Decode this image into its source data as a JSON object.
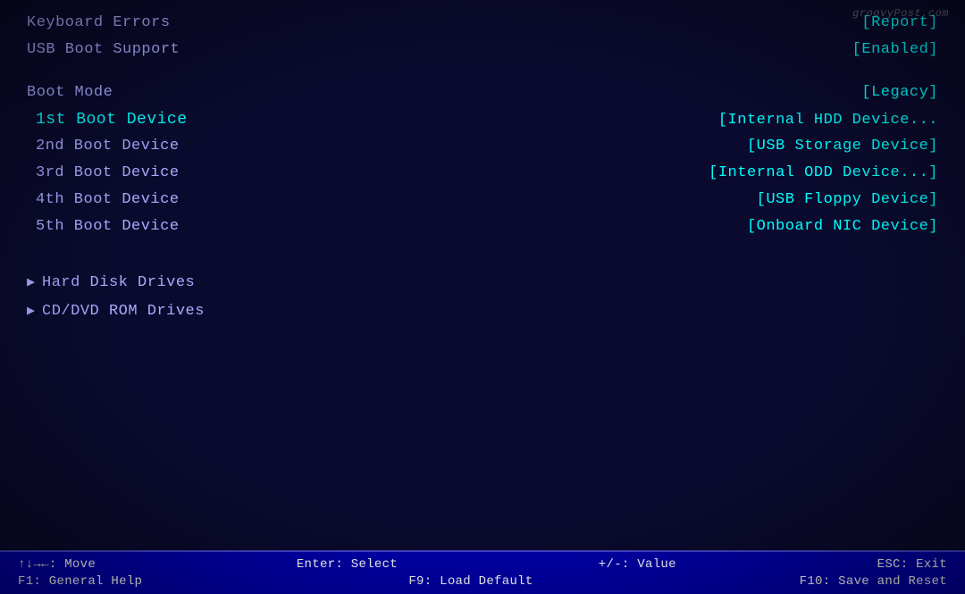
{
  "watermark": "groovyPost.com",
  "rows": [
    {
      "id": "keyboard-errors",
      "label": "Keyboard Errors",
      "value": "[Report]",
      "indent": false,
      "selected": false
    },
    {
      "id": "usb-boot-support",
      "label": "USB Boot Support",
      "value": "[Enabled]",
      "indent": false,
      "selected": false
    },
    {
      "id": "spacer1",
      "label": "",
      "value": "",
      "spacer": true
    },
    {
      "id": "boot-mode",
      "label": "Boot Mode",
      "value": "[Legacy]",
      "indent": false,
      "selected": false
    },
    {
      "id": "1st-boot",
      "label": "1st Boot Device",
      "value": "[Internal HDD Device...",
      "indent": true,
      "selected": true
    },
    {
      "id": "2nd-boot",
      "label": "2nd Boot Device",
      "value": "[USB Storage Device]",
      "indent": true,
      "selected": false
    },
    {
      "id": "3rd-boot",
      "label": "3rd Boot Device",
      "value": "[Internal ODD Device...]",
      "indent": true,
      "selected": false
    },
    {
      "id": "4th-boot",
      "label": "4th Boot Device",
      "value": "[USB Floppy Device]",
      "indent": true,
      "selected": false
    },
    {
      "id": "5th-boot",
      "label": "5th Boot Device",
      "value": "[Onboard NIC Device]",
      "indent": true,
      "selected": false
    },
    {
      "id": "spacer2",
      "label": "",
      "value": "",
      "spacer": true
    }
  ],
  "submenus": [
    {
      "id": "hdd",
      "label": "Hard Disk Drives"
    },
    {
      "id": "cddvd",
      "label": "CD/DVD ROM Drives"
    }
  ],
  "statusBar": {
    "row1": [
      {
        "key": "↑↓→←",
        "desc": ": Move"
      },
      {
        "key": "Enter",
        "desc": ": Select"
      },
      {
        "key": "+/-",
        "desc": ": Value"
      },
      {
        "key": "ESC",
        "desc": ": Exit"
      }
    ],
    "row2": [
      {
        "key": "F1",
        "desc": ": General Help"
      },
      {
        "key": "F9",
        "desc": ": Load Default"
      },
      {
        "key": "F10",
        "desc": ": Save and Reset"
      }
    ]
  }
}
